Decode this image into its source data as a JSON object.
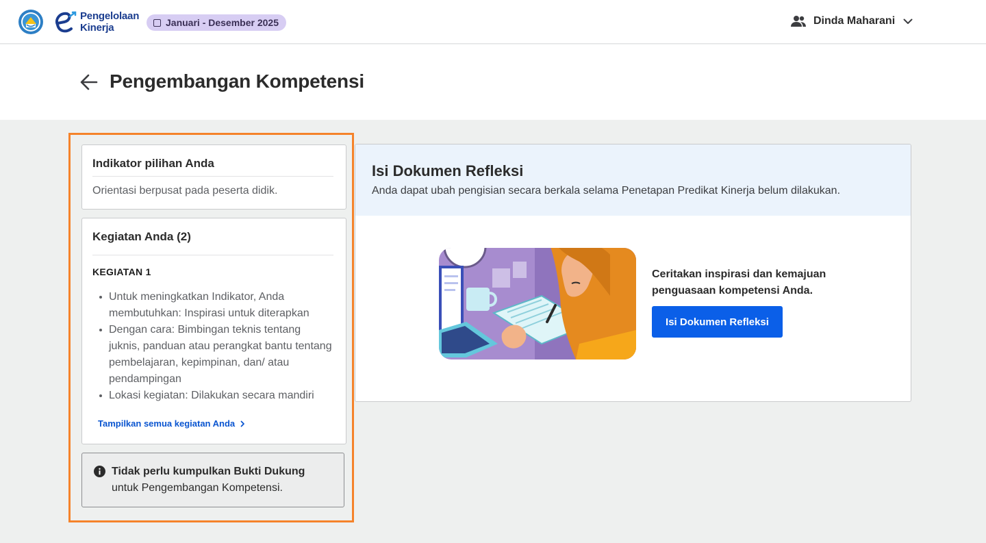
{
  "header": {
    "brand_line1": "Pengelolaan",
    "brand_line2": "Kinerja",
    "period": "Januari - Desember 2025",
    "user_name": "Dinda Maharani",
    "user_icon": "users-icon",
    "dropdown_icon": "chevron-down-icon"
  },
  "page": {
    "title": "Pengembangan Kompetensi",
    "back_icon": "arrow-left-icon"
  },
  "indikator": {
    "heading": "Indikator pilihan Anda",
    "text": "Orientasi berpusat pada peserta didik."
  },
  "kegiatan": {
    "heading": "Kegiatan Anda (2)",
    "label": "KEGIATAN 1",
    "items": [
      "Untuk meningkatkan Indikator, Anda membutuhkan: Inspirasi untuk diterapkan",
      "Dengan cara: Bimbingan teknis tentang juknis, panduan atau perangkat bantu tentang pembelajaran, kepimpinan, dan/ atau pendampingan",
      "Lokasi kegiatan: Dilakukan secara mandiri"
    ],
    "show_all": "Tampilkan semua kegiatan Anda"
  },
  "note": {
    "strong": "Tidak perlu kumpulkan Bukti Dukung",
    "rest": "untuk Pengembangan Kompetensi."
  },
  "refleksi": {
    "title": "Isi Dokumen Refleksi",
    "subtitle": "Anda dapat ubah pengisian secara berkala selama Penetapan Predikat Kinerja belum dilakukan.",
    "cta_text": "Ceritakan inspirasi dan kemajuan penguasaan kompetensi Anda.",
    "button": "Isi Dokumen Refleksi"
  },
  "colors": {
    "accent": "#0b5fe8",
    "highlight": "#f5832a",
    "badge": "#d7cdf3"
  }
}
